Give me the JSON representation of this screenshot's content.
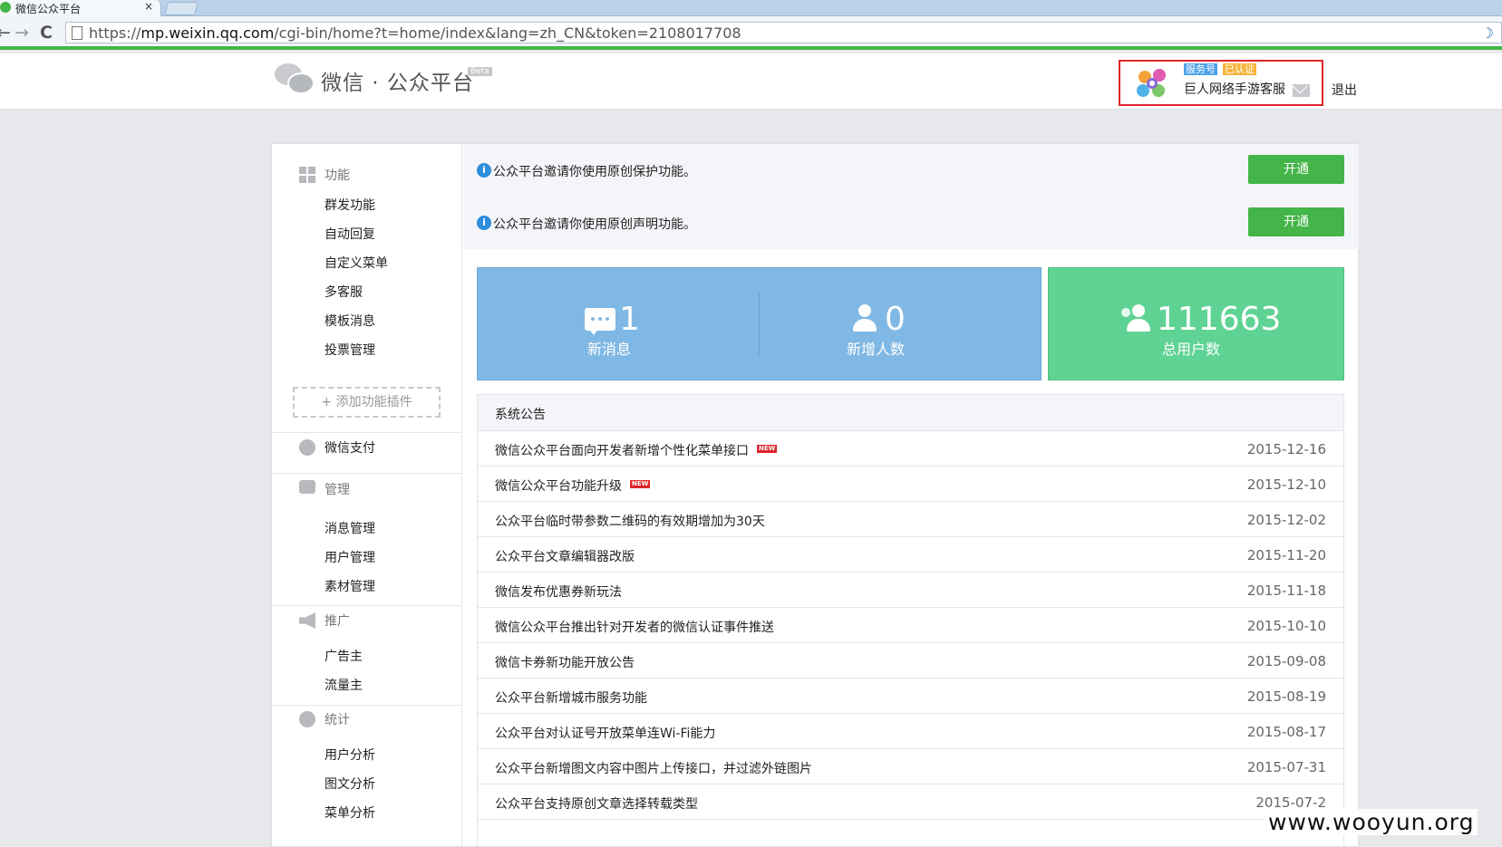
{
  "browser": {
    "tab_title": "微信公众平台",
    "tab_close": "×",
    "back_glyph": "←",
    "forward_glyph": "→",
    "reload_glyph": "C",
    "url_prefix": "https://",
    "url_host": "mp.weixin.qq.com",
    "url_path": "/cgi-bin/home?t=home/index&lang=zh_CN&token=2108017708"
  },
  "header": {
    "logo_text": "微信 · 公众平台",
    "beta": "Beta",
    "account_type": "服务号",
    "account_status": "已认证",
    "account_name": "巨人网络手游客服",
    "logout": "退出"
  },
  "sidebar": {
    "sections": [
      {
        "title": "功能",
        "icon": "grid-icon",
        "items": [
          "群发功能",
          "自动回复",
          "自定义菜单",
          "多客服",
          "模板消息",
          "投票管理"
        ]
      },
      {
        "title": "微信支付",
        "icon": "wechat-pay-icon",
        "items": []
      },
      {
        "title": "管理",
        "icon": "inbox-icon",
        "items": [
          "消息管理",
          "用户管理",
          "素材管理"
        ]
      },
      {
        "title": "推广",
        "icon": "megaphone-icon",
        "items": [
          "广告主",
          "流量主"
        ]
      },
      {
        "title": "统计",
        "icon": "pie-chart-icon",
        "items": [
          "用户分析",
          "图文分析",
          "菜单分析"
        ]
      }
    ],
    "add_plugin": "添加功能插件",
    "add_glyph": "+"
  },
  "notices": [
    {
      "text": "公众平台邀请你使用原创保护功能。",
      "button": "开通"
    },
    {
      "text": "公众平台邀请你使用原创声明功能。",
      "button": "开通"
    }
  ],
  "stats": {
    "new_messages": {
      "value": "1",
      "label": "新消息"
    },
    "new_users": {
      "value": "0",
      "label": "新增人数"
    },
    "total_users": {
      "value": "111663",
      "label": "总用户数"
    }
  },
  "announcements": {
    "title": "系统公告",
    "new_badge": "NEW",
    "items": [
      {
        "text": "微信公众平台面向开发者新增个性化菜单接口",
        "date": "2015-12-16",
        "new": true
      },
      {
        "text": "微信公众平台功能升级",
        "date": "2015-12-10",
        "new": true
      },
      {
        "text": "公众平台临时带参数二维码的有效期增加为30天",
        "date": "2015-12-02",
        "new": false
      },
      {
        "text": "公众平台文章编辑器改版",
        "date": "2015-11-20",
        "new": false
      },
      {
        "text": "微信发布优惠券新玩法",
        "date": "2015-11-18",
        "new": false
      },
      {
        "text": "微信公众平台推出针对开发者的微信认证事件推送",
        "date": "2015-10-10",
        "new": false
      },
      {
        "text": "微信卡券新功能开放公告",
        "date": "2015-09-08",
        "new": false
      },
      {
        "text": "公众平台新增城市服务功能",
        "date": "2015-08-19",
        "new": false
      },
      {
        "text": "公众平台对认证号开放菜单连Wi-Fi能力",
        "date": "2015-08-17",
        "new": false
      },
      {
        "text": "公众平台新增图文内容中图片上传接口，并过滤外链图片",
        "date": "2015-07-31",
        "new": false
      },
      {
        "text": "公众平台支持原创文章选择转载类型",
        "date": "2015-07-2",
        "new": false
      }
    ]
  },
  "watermark": "www.wooyun.org",
  "colors": {
    "accent_green": "#44b549",
    "stat_blue": "#7fb8e4",
    "stat_green": "#5fd394",
    "highlight_red": "#e0262b"
  }
}
